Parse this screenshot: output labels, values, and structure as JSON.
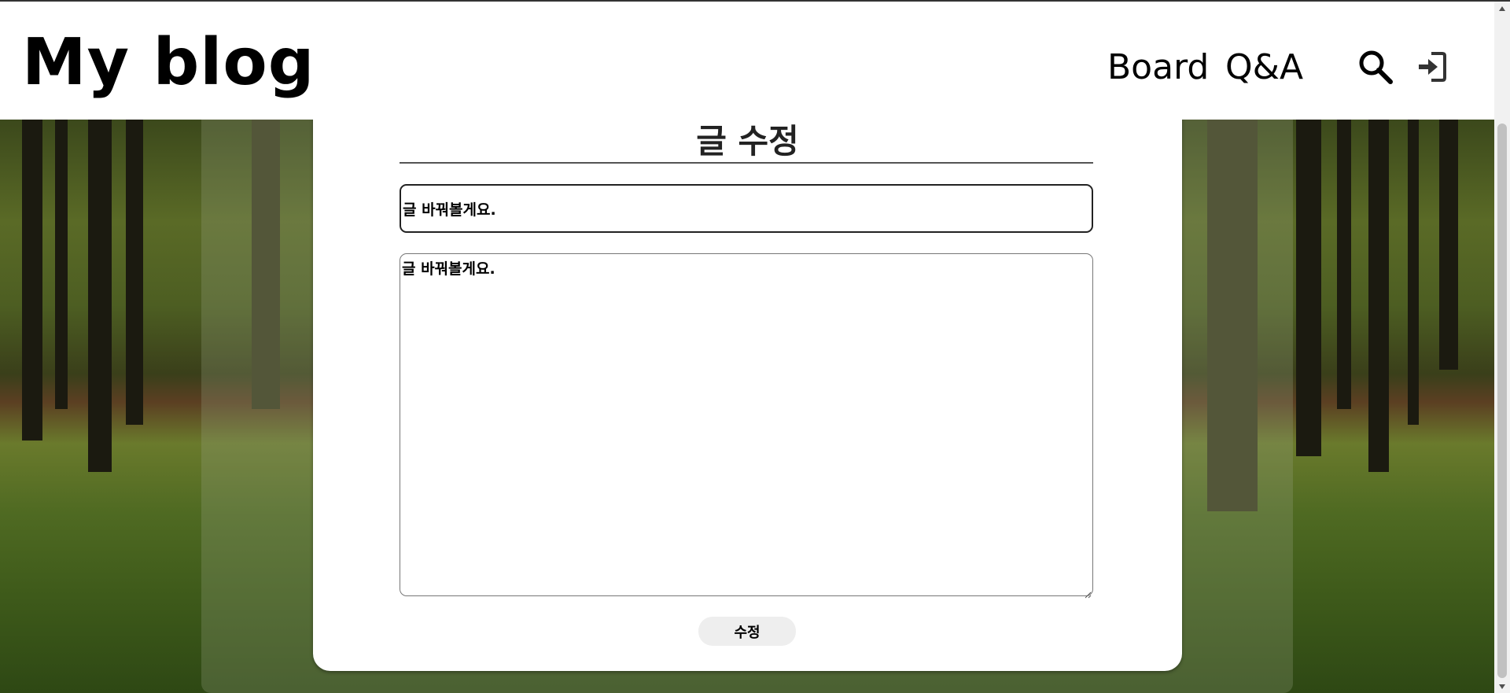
{
  "header": {
    "logo": "My blog",
    "nav": {
      "board": "Board",
      "qa": "Q&A"
    },
    "icons": {
      "search": "search-icon",
      "login": "login-icon"
    }
  },
  "editor": {
    "page_title": "글 수정",
    "title_value": "글 바꿔볼게요.",
    "content_value": "글 바꿔볼게요.",
    "submit_label": "수정"
  },
  "colors": {
    "header_bg": "#ffffff",
    "card_bg": "#ffffff",
    "button_bg": "#eeeeee",
    "text": "#000000"
  }
}
